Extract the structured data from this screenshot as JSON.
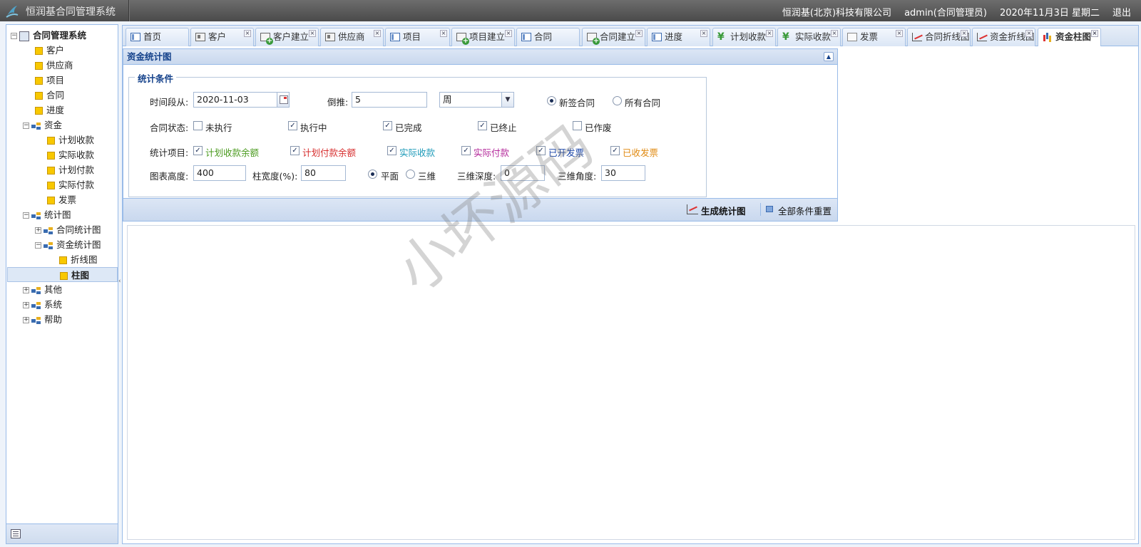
{
  "header": {
    "app_title": "恒润基合同管理系统",
    "company": "恒润基(北京)科技有限公司",
    "user": "admin(合同管理员)",
    "date": "2020年11月3日 星期二",
    "logout": "退出"
  },
  "sidebar": {
    "root": "合同管理系统",
    "items": [
      {
        "label": "客户"
      },
      {
        "label": "供应商"
      },
      {
        "label": "项目"
      },
      {
        "label": "合同"
      },
      {
        "label": "进度"
      },
      {
        "label": "资金"
      },
      {
        "label": "计划收款"
      },
      {
        "label": "实际收款"
      },
      {
        "label": "计划付款"
      },
      {
        "label": "实际付款"
      },
      {
        "label": "发票"
      },
      {
        "label": "统计图"
      },
      {
        "label": "合同统计图"
      },
      {
        "label": "资金统计图"
      },
      {
        "label": "折线图"
      },
      {
        "label": "柱图"
      },
      {
        "label": "其他"
      },
      {
        "label": "系统"
      },
      {
        "label": "帮助"
      }
    ]
  },
  "tabs": [
    {
      "label": "首页",
      "icon": "window-icon",
      "closable": false
    },
    {
      "label": "客户",
      "icon": "card-icon",
      "closable": true
    },
    {
      "label": "客户建立",
      "icon": "add-icon",
      "closable": true
    },
    {
      "label": "供应商",
      "icon": "card-icon",
      "closable": true
    },
    {
      "label": "项目",
      "icon": "window-icon",
      "closable": true
    },
    {
      "label": "项目建立",
      "icon": "add-icon",
      "closable": true
    },
    {
      "label": "合同",
      "icon": "window-icon",
      "closable": false
    },
    {
      "label": "合同建立",
      "icon": "add-icon",
      "closable": true
    },
    {
      "label": "进度",
      "icon": "window-icon",
      "closable": true
    },
    {
      "label": "计划收款",
      "icon": "yen-icon",
      "closable": true
    },
    {
      "label": "实际收款",
      "icon": "yen-icon",
      "closable": true
    },
    {
      "label": "发票",
      "icon": "doc-icon",
      "closable": true
    },
    {
      "label": "合同折线图",
      "icon": "line-chart-icon",
      "closable": true
    },
    {
      "label": "资金折线图",
      "icon": "line-chart-icon",
      "closable": true
    },
    {
      "label": "资金柱图",
      "icon": "bar-chart-icon",
      "closable": true,
      "active": true
    }
  ],
  "panel": {
    "title": "资金统计图",
    "fieldset_legend": "统计条件",
    "time_from_label": "时间段从:",
    "time_from_value": "2020-11-03",
    "backward_label": "倒推:",
    "backward_value": "5",
    "unit_value": "周",
    "radio_new": "新签合同",
    "radio_all": "所有合同",
    "status_label": "合同状态:",
    "status": [
      {
        "label": "未执行",
        "checked": false
      },
      {
        "label": "执行中",
        "checked": true
      },
      {
        "label": "已完成",
        "checked": true
      },
      {
        "label": "已终止",
        "checked": true
      },
      {
        "label": "已作废",
        "checked": false
      }
    ],
    "items_label": "统计项目:",
    "items": [
      {
        "label": "计划收款余额",
        "checked": true,
        "color": "#4a9a1e"
      },
      {
        "label": "计划付款余额",
        "checked": true,
        "color": "#d62b2b"
      },
      {
        "label": "实际收款",
        "checked": true,
        "color": "#1c9ab8"
      },
      {
        "label": "实际付款",
        "checked": true,
        "color": "#b3279a"
      },
      {
        "label": "已开发票",
        "checked": true,
        "color": "#1b46a8"
      },
      {
        "label": "已收发票",
        "checked": true,
        "color": "#e08a12"
      }
    ],
    "chart_height_label": "图表高度:",
    "chart_height_value": "400",
    "bar_width_label": "柱宽度(%):",
    "bar_width_value": "80",
    "mode_flat": "平面",
    "mode_3d": "三维",
    "depth_label": "三维深度:",
    "depth_value": "0",
    "angle_label": "三维角度:",
    "angle_value": "30",
    "generate_button": "生成统计图",
    "reset_button": "全部条件重置"
  },
  "watermark": "小坏源码"
}
